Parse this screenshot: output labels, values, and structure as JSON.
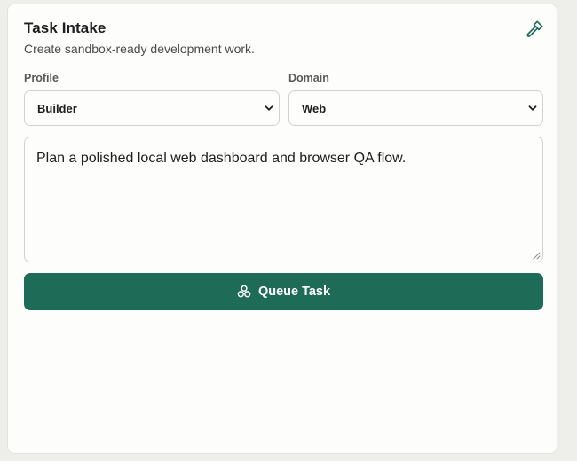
{
  "panel": {
    "title": "Task Intake",
    "subtitle": "Create sandbox-ready development work.",
    "header_icon": "hammer-icon"
  },
  "form": {
    "profile": {
      "label": "Profile",
      "selected": "Builder"
    },
    "domain": {
      "label": "Domain",
      "selected": "Web"
    },
    "task_description": "Plan a polished local web dashboard and browser QA flow.",
    "submit": {
      "label": "Queue Task",
      "icon": "nodes-icon"
    }
  },
  "colors": {
    "accent": "#1e6b57",
    "background": "#eeeeea",
    "panel": "#fdfdfc",
    "border": "#d3d3cf"
  }
}
